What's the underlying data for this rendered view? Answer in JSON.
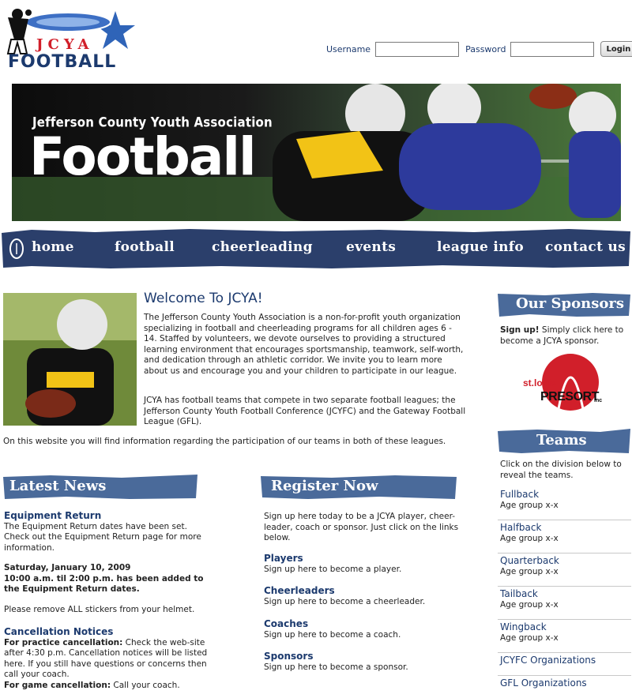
{
  "logo": {
    "line1": "JCYA",
    "line2": "FOOTBALL"
  },
  "login": {
    "username_label": "Username",
    "password_label": "Password",
    "button": "Login",
    "username_value": "",
    "password_value": ""
  },
  "banner": {
    "subtitle": "Jefferson County Youth Association",
    "title": "Football"
  },
  "nav": {
    "items": [
      "home",
      "football",
      "cheerleading",
      "events",
      "league info",
      "contact us"
    ]
  },
  "welcome": {
    "title": "Welcome To JCYA!",
    "p1": "The Jefferson County Youth Association is a non-for-profit youth organization specializing in football and cheerleading programs for all children ages 6 - 14. Staffed by volunteers, we devote ourselves to providing a structured learning environment that encourages sportsmanship, teamwork, self-worth, and dedication through an athletic corridor. We invite you to learn more about us and encourage you and your children to participate in our league.",
    "p2": "JCYA has football teams that compete in two separate football leagues; the Jefferson County Youth Football Conference (JCYFC) and the Gateway Football League (GFL).",
    "p3": "On this website you will find information regarding the participation of our teams in both of these leagues."
  },
  "news": {
    "heading": "Latest News",
    "item1_title": "Equipment Return",
    "item1_text": "The Equipment Return dates have been set. Check out the Equipment Return page for more information.",
    "item1_date": "Saturday, January 10, 2009",
    "item1_time": "10:00 a.m. til 2:00 p.m. has been added to the Equipment Return dates.",
    "item1_note": "Please remove ALL stickers from your helmet.",
    "item2_title": "Cancellation Notices",
    "item2_label1": "For practice cancellation:",
    "item2_text1": " Check the web-site after 4:30 p.m. Cancellation notices will be listed here. If you still have questions or concerns then call your coach.",
    "item2_label2": "For game cancellation:",
    "item2_text2": " Call your coach."
  },
  "register": {
    "heading": "Register Now",
    "intro": "Sign up here today to be a JCYA player, cheer-leader, coach or sponsor. Just click on the links below.",
    "links": [
      {
        "title": "Players",
        "text": "Sign up here to become a player."
      },
      {
        "title": "Cheerleaders",
        "text": "Sign up here to become a cheerleader."
      },
      {
        "title": "Coaches",
        "text": "Sign up here to become a coach."
      },
      {
        "title": "Sponsors",
        "text": "Sign up here to become a sponsor."
      }
    ]
  },
  "sponsors": {
    "heading": "Our Sponsors",
    "signup_bold": "Sign up!",
    "signup_text": " Simply click here to become a JCYA sponsor.",
    "logo_line1": "st.louis",
    "logo_line2": "PRESORT",
    "logo_suffix": "inc"
  },
  "teams": {
    "heading": "Teams",
    "intro": "Click on the division below to reveal the teams.",
    "divisions": [
      {
        "name": "Fullback",
        "age": "Age group x-x"
      },
      {
        "name": "Halfback",
        "age": "Age group x-x"
      },
      {
        "name": "Quarterback",
        "age": "Age group x-x"
      },
      {
        "name": "Tailback",
        "age": "Age group x-x"
      },
      {
        "name": "Wingback",
        "age": "Age group x-x"
      }
    ],
    "orgs": [
      "JCYFC Organizations",
      "GFL Organizations"
    ]
  },
  "colors": {
    "navy": "#1c3a6e",
    "nav_blue": "#2b3f6b",
    "brush_blue": "#4a6a9a",
    "red": "#d11f2a"
  }
}
